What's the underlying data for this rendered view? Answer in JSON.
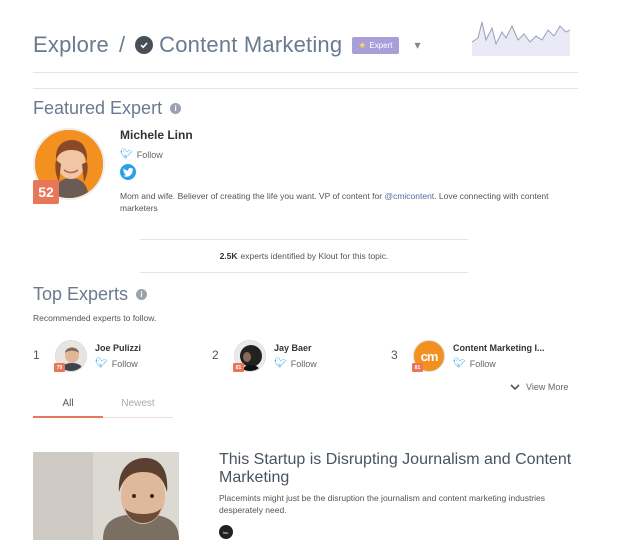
{
  "header": {
    "explore_label": "Explore",
    "separator": "/",
    "topic_name": "Content Marketing",
    "expert_badge": "Expert",
    "caret": "▾"
  },
  "featured": {
    "section_title": "Featured Expert",
    "name": "Michele Linn",
    "follow_label": "Follow",
    "score": "52",
    "bio_before": "Mom and wife. Believer of creating the life you want. VP of content for ",
    "bio_mention": "@cmicontent",
    "bio_after": ". Love connecting with content marketers",
    "identified_count": "2.5K",
    "identified_text": "experts identified by Klout for this topic."
  },
  "top_experts": {
    "section_title": "Top Experts",
    "subtitle": "Recommended experts to follow.",
    "experts": [
      {
        "rank": "1",
        "name": "Joe Pulizzi",
        "follow_label": "Follow",
        "score": "79"
      },
      {
        "rank": "2",
        "name": "Jay Baer",
        "follow_label": "Follow",
        "score": "81"
      },
      {
        "rank": "3",
        "name": "Content Marketing I...",
        "follow_label": "Follow",
        "score": "81",
        "logo_text": "cm"
      }
    ],
    "view_more": "View More"
  },
  "tabs": [
    {
      "label": "All",
      "active": true
    },
    {
      "label": "Newest",
      "active": false
    }
  ],
  "article": {
    "title": "This Startup is Disrupting Journalism and Content Marketing",
    "summary": "Placemints might just be the disruption the journalism and content marketing industries desperately need.",
    "source_icon_text": "Inc."
  },
  "colors": {
    "accent": "#e8765a",
    "twitter": "#2b9fe8",
    "badge": "#a89fd8",
    "heading": "#6a7a8f"
  }
}
